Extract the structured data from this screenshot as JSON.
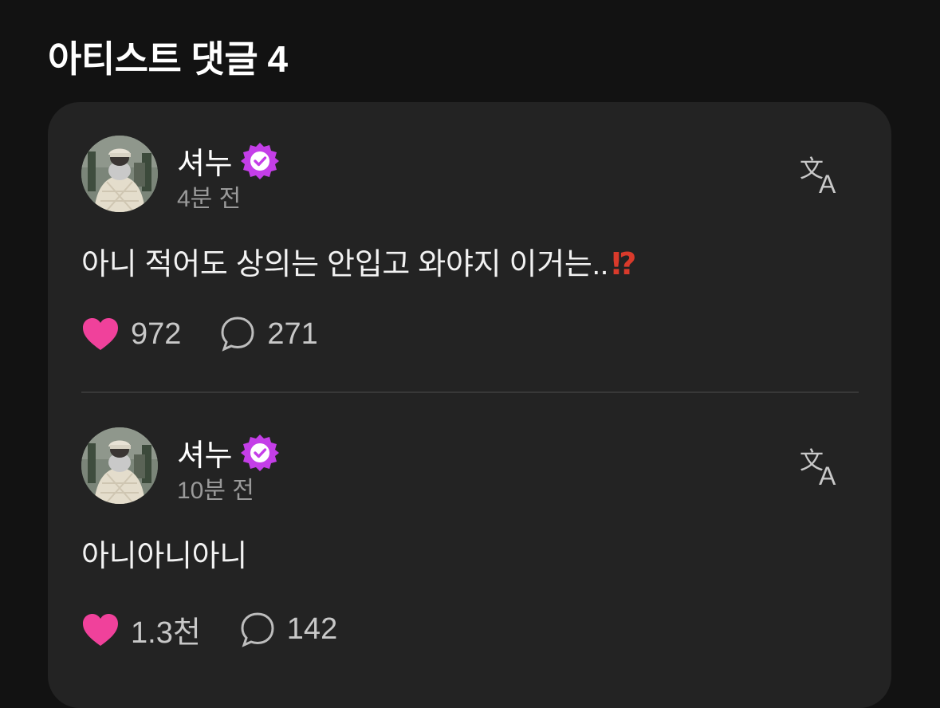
{
  "section": {
    "title": "아티스트 댓글 4"
  },
  "comments": [
    {
      "author": "셔누",
      "time": "4분 전",
      "text": "아니 적어도 상의는 안입고 와야지 이거는..",
      "emoji": "⁉",
      "likes": "972",
      "replies": "271"
    },
    {
      "author": "셔누",
      "time": "10분 전",
      "text": "아니아니아니",
      "emoji": "",
      "likes": "1.3천",
      "replies": "142"
    }
  ],
  "icons": {
    "verified": "verified-badge-icon",
    "translate": "translate-icon",
    "like": "heart-icon",
    "reply": "speech-bubble-icon"
  },
  "colors": {
    "background": "#121212",
    "card": "#232323",
    "verified_badge": "#c43ee8",
    "heart": "#f0419b",
    "muted_text": "#9a9a9a"
  }
}
